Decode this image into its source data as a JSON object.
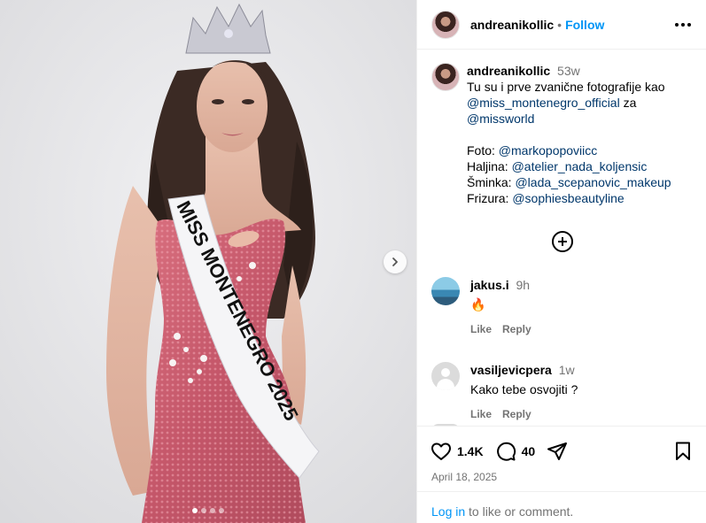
{
  "post": {
    "author": "andreanikollic",
    "follow_label": "Follow",
    "separator": "•",
    "caption": {
      "username": "andreanikollic",
      "time": "53w",
      "line1": "Tu su i prve zvanične fotografije kao",
      "mention1": "@miss_montenegro_official",
      "line1_end": " za",
      "mention2": "@missworld",
      "credits": [
        {
          "label": "Foto: ",
          "mention": "@markopopoviicc"
        },
        {
          "label": "Haljina: ",
          "mention": "@atelier_nada_koljensic"
        },
        {
          "label": "Šminka: ",
          "mention": "@lada_scepanovic_makeup"
        },
        {
          "label": "Frizura: ",
          "mention": "@sophiesbeautyline"
        }
      ]
    },
    "sash_text": "MISS MONTENEGRO 2025",
    "likes": "1.4K",
    "comments_count": "40",
    "date": "April 18, 2025"
  },
  "comments": [
    {
      "username": "jakus.i",
      "time": "9h",
      "text": "🔥",
      "like": "Like",
      "reply": "Reply"
    },
    {
      "username": "vasiljevicpera",
      "time": "1w",
      "text": "Kako tebe osvojiti ?",
      "like": "Like",
      "reply": "Reply"
    }
  ],
  "footer": {
    "login_link": "Log in",
    "login_text": " to like or comment."
  },
  "icons": {
    "heart": "heart-icon",
    "comment": "comment-icon",
    "share": "share-icon",
    "save": "bookmark-icon",
    "more": "more-options-icon",
    "next": "chevron-right-icon",
    "load_more": "plus-circle-icon"
  },
  "colors": {
    "link": "#0095f6",
    "mention": "#00376b",
    "secondary": "#737373",
    "dress": "#c95a6c"
  },
  "carousel": {
    "total_slides": 4,
    "current_slide": 1
  }
}
